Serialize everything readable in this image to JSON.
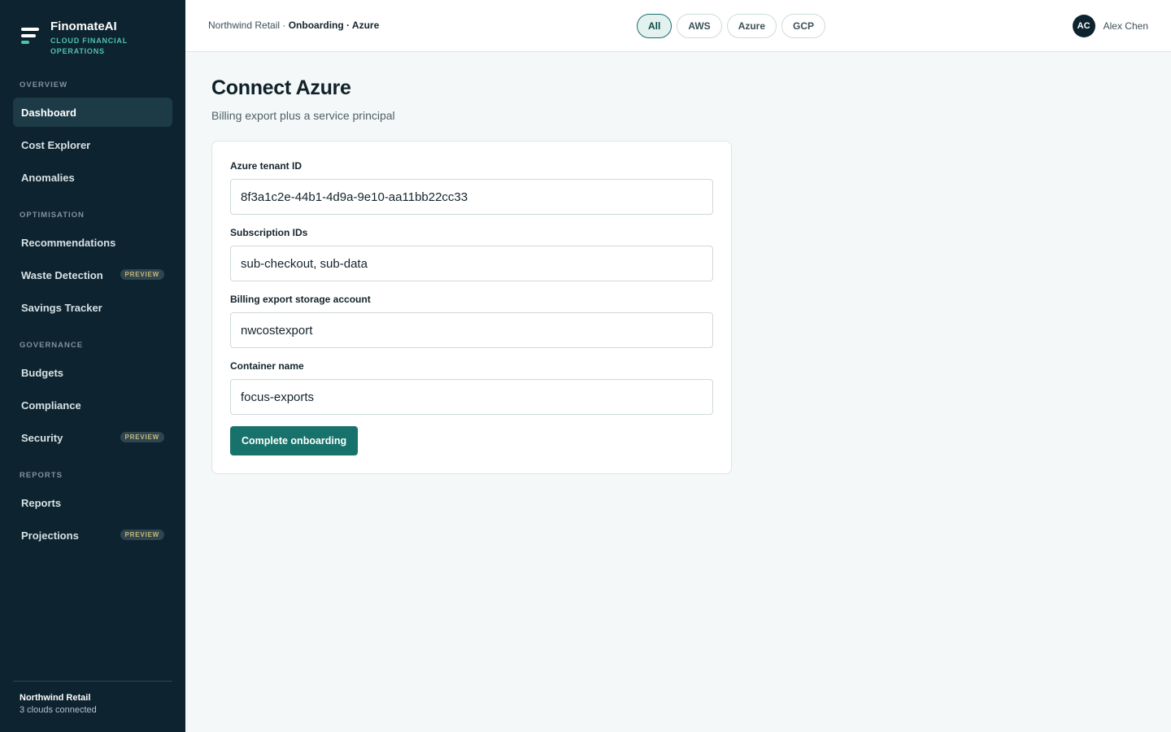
{
  "brand": {
    "name": "FinomateAI",
    "tagline": "Cloud Financial Operations"
  },
  "sidebar": {
    "sections": [
      {
        "label": "Overview"
      },
      {
        "label": "Optimisation"
      },
      {
        "label": "Governance"
      },
      {
        "label": "Reports"
      }
    ],
    "items": [
      {
        "label": "Dashboard",
        "active": true
      },
      {
        "label": "Cost Explorer"
      },
      {
        "label": "Anomalies"
      },
      {
        "label": "Recommendations"
      },
      {
        "label": "Waste Detection",
        "badge": "PREVIEW"
      },
      {
        "label": "Savings Tracker"
      },
      {
        "label": "Budgets"
      },
      {
        "label": "Compliance"
      },
      {
        "label": "Security",
        "badge": "PREVIEW"
      },
      {
        "label": "Reports"
      },
      {
        "label": "Projections",
        "badge": "PREVIEW"
      }
    ],
    "footer": {
      "org": "Northwind Retail",
      "status": "3 clouds connected"
    }
  },
  "header": {
    "breadcrumb_prefix": "Northwind Retail · ",
    "breadcrumb_current": "Onboarding · Azure",
    "filters": [
      {
        "label": "All",
        "active": true
      },
      {
        "label": "AWS"
      },
      {
        "label": "Azure"
      },
      {
        "label": "GCP"
      }
    ],
    "user": {
      "initials": "AC",
      "name": "Alex Chen"
    }
  },
  "main": {
    "title": "Connect Azure",
    "subtitle": "Billing export plus a service principal",
    "form": {
      "fields": [
        {
          "label": "Azure tenant ID",
          "value": "8f3a1c2e-44b1-4d9a-9e10-aa11bb22cc33"
        },
        {
          "label": "Subscription IDs",
          "value": "sub-checkout, sub-data"
        },
        {
          "label": "Billing export storage account",
          "value": "nwcostexport"
        },
        {
          "label": "Container name",
          "value": "focus-exports"
        }
      ],
      "submit_label": "Complete onboarding"
    }
  },
  "colors": {
    "sidebar_bg": "#0e2330",
    "accent": "#17726b",
    "brand_accent": "#4fc2ac",
    "page_bg": "#f5f8f8"
  }
}
